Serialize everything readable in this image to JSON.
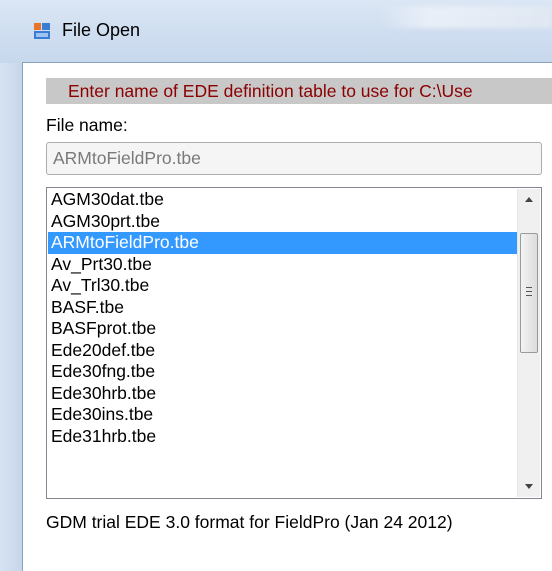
{
  "window": {
    "title": "File Open",
    "app_icon": "form-window-icon"
  },
  "prompt": {
    "text": "Enter name of EDE definition table to use for C:\\Use",
    "color": "#8b0000"
  },
  "file_name": {
    "label": "File name:",
    "value": "ARMtoFieldPro.tbe"
  },
  "file_list": {
    "items": [
      "AGM30dat.tbe",
      "AGM30prt.tbe",
      "ARMtoFieldPro.tbe",
      "Av_Prt30.tbe",
      "Av_Trl30.tbe",
      "BASF.tbe",
      "BASFprot.tbe",
      "Ede20def.tbe",
      "Ede30fng.tbe",
      "Ede30hrb.tbe",
      "Ede30ins.tbe",
      "Ede31hrb.tbe"
    ],
    "selected_index": 2,
    "selection_color": "#3399ff"
  },
  "status": {
    "description": "GDM trial EDE 3.0 format for FieldPro (Jan 24 2012)"
  }
}
